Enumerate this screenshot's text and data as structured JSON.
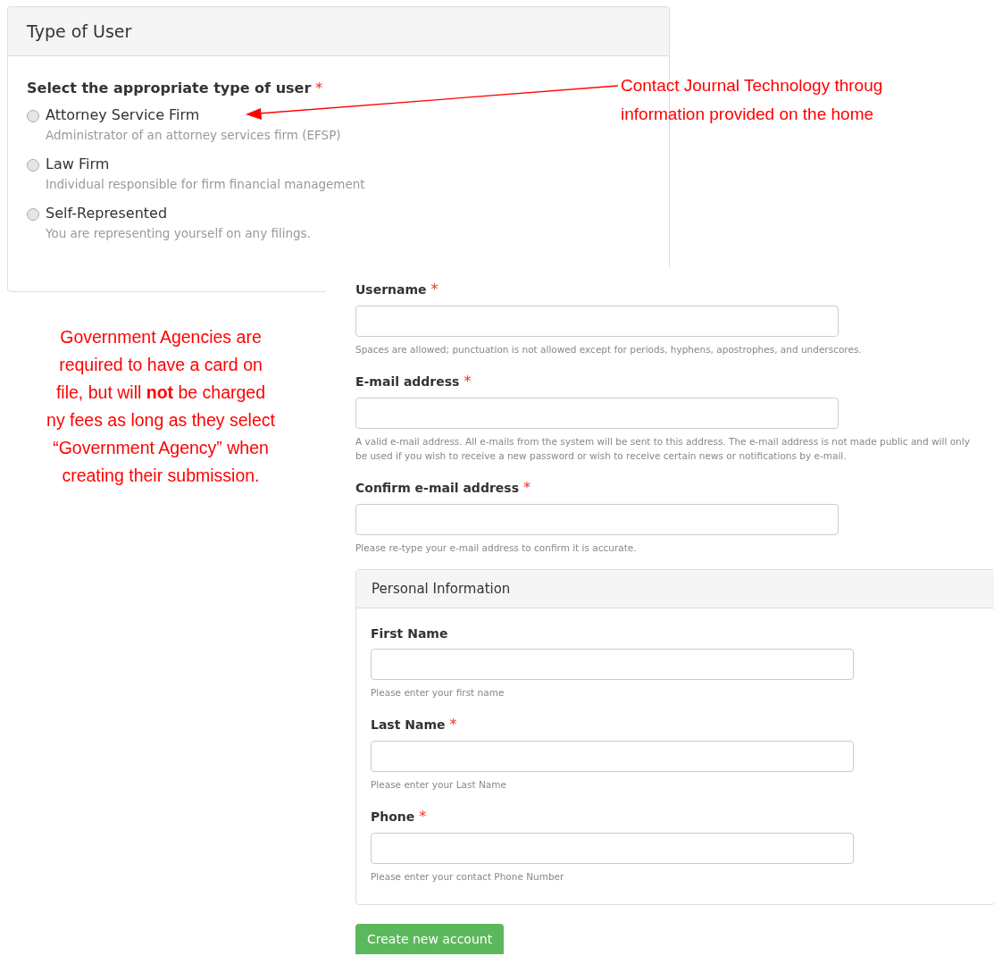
{
  "type_of_user_panel": {
    "title": "Type of User",
    "question": "Select the appropriate type of user",
    "required": true,
    "options": [
      {
        "label": "Attorney Service Firm",
        "description": "Administrator of an attorney services firm (EFSP)",
        "selected": false
      },
      {
        "label": "Law Firm",
        "description": "Individual responsible for firm financial management",
        "selected": false
      },
      {
        "label": "Self-Represented",
        "description": "You are representing yourself on any filings.",
        "selected": false
      }
    ]
  },
  "required_mark": "*",
  "callout": {
    "lines": [
      "Contact Journal Technology throug",
      "information provided on the home"
    ]
  },
  "note": {
    "lines": [
      "Government Agencies are",
      "required to have a card on",
      "file, but will **not** be charged",
      "ny fees as long as they select",
      "“Government Agency” when",
      "creating their submission."
    ]
  },
  "account_fields": [
    {
      "label": "Username",
      "required": true,
      "help": "Spaces are allowed; punctuation is not allowed except for periods, hyphens, apostrophes, and underscores."
    },
    {
      "label": "E-mail address",
      "required": true,
      "help": "A valid e-mail address. All e-mails from the system will be sent to this address. The e-mail address is not made public and will only be used if you wish to receive a new password or wish to receive certain news or notifications by e-mail."
    },
    {
      "label": "Confirm e-mail address",
      "required": true,
      "help": "Please re-type your e-mail address to confirm it is accurate."
    }
  ],
  "personal_panel": {
    "title": "Personal Information",
    "fields": [
      {
        "label": "First Name",
        "required": false,
        "help": "Please enter your first name"
      },
      {
        "label": "Last Name",
        "required": true,
        "help": "Please enter your Last Name"
      },
      {
        "label": "Phone",
        "required": true,
        "help": "Please enter your contact Phone Number"
      }
    ]
  },
  "submit_button": "Create new account"
}
